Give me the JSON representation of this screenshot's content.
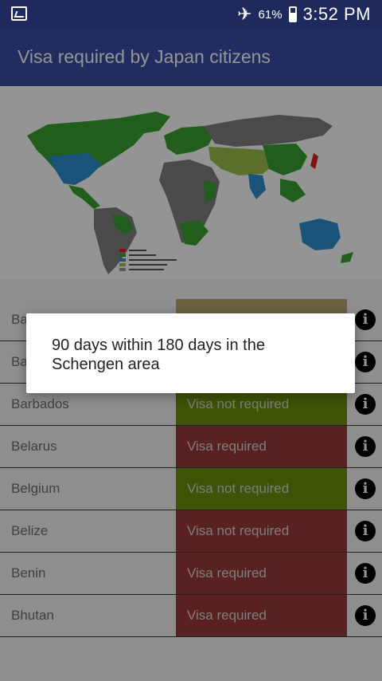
{
  "status_bar": {
    "battery_percent": "61%",
    "battery_level": 0.61,
    "time": "3:52 PM",
    "icons": [
      "gallery-icon",
      "airplane-mode-icon",
      "battery-icon"
    ]
  },
  "app_bar": {
    "title": "Visa required by Japan citizens"
  },
  "map": {
    "legend_colors": [
      "#e02020",
      "#3aa030",
      "#2b8fd0",
      "#9bc24a",
      "#9e9e9e"
    ]
  },
  "rows": [
    {
      "country": "Ba",
      "status": "",
      "color": "#b8aa70"
    },
    {
      "country": "Ba",
      "status": "",
      "color": "#9c3a3a"
    },
    {
      "country": "Barbados",
      "status": "Visa not required",
      "color": "#6b8f0a"
    },
    {
      "country": "Belarus",
      "status": "Visa required",
      "color": "#9c3a3a"
    },
    {
      "country": "Belgium",
      "status": "Visa not required",
      "color": "#6b8f0a"
    },
    {
      "country": "Belize",
      "status": "Visa not required",
      "color": "#9c3a3a"
    },
    {
      "country": "Benin",
      "status": "Visa required",
      "color": "#9c3a3a"
    },
    {
      "country": "Bhutan",
      "status": "Visa required",
      "color": "#9c3a3a"
    }
  ],
  "dialog": {
    "message": "90 days within 180 days in the Schengen area"
  }
}
